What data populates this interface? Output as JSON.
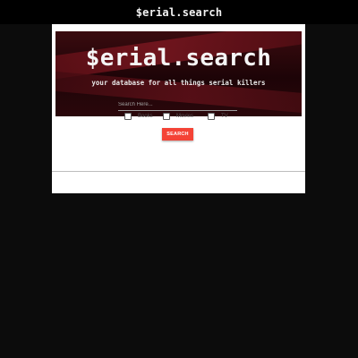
{
  "header": {
    "brand": "$erial.search"
  },
  "banner": {
    "title": "$erial.search",
    "subtitle": "your database for all things serial killers"
  },
  "search": {
    "placeholder": "Search Here...",
    "value": "",
    "button_label": "SEARCH"
  },
  "filters": [
    {
      "label": "Books",
      "checked": false
    },
    {
      "label": "Movies",
      "checked": false
    },
    {
      "label": "TV",
      "checked": false
    }
  ],
  "colors": {
    "background": "#0c0c0c",
    "header": "#000000",
    "card": "#ffffff",
    "button": "#f44336"
  }
}
